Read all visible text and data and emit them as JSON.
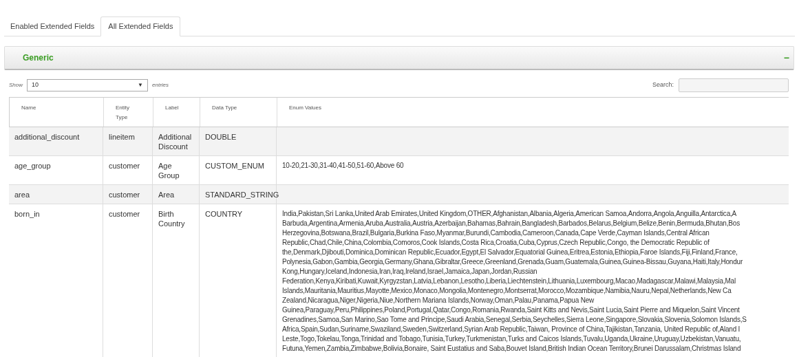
{
  "tabs": [
    {
      "label": "Enabled Extended Fields",
      "selected": false
    },
    {
      "label": "All Extended Fields",
      "selected": true
    }
  ],
  "panel": {
    "title": "Generic",
    "expanded": true,
    "toggle": "−"
  },
  "length_menu": {
    "before": "Show",
    "value": "10",
    "caret": "▼",
    "after": "entries"
  },
  "search": {
    "label": "Search:"
  },
  "table": {
    "columns": [
      [
        "Name"
      ],
      [
        "Entity",
        "Type"
      ],
      [
        "Label"
      ],
      [
        "Data Type"
      ],
      [
        "Enum Values"
      ]
    ],
    "rows": [
      {
        "name": "additional_discount",
        "entity_type": "lineitem",
        "label": [
          "Additional",
          "Discount"
        ],
        "data_type": "DOUBLE",
        "enum_values": []
      },
      {
        "name": "age_group",
        "entity_type": "customer",
        "label": [
          "Age",
          "Group"
        ],
        "data_type": "CUSTOM_ENUM",
        "enum_values": [
          "10-20,21-30,31-40,41-50,51-60,Above 60"
        ]
      },
      {
        "name": "area",
        "entity_type": "customer",
        "label": [
          "Area"
        ],
        "data_type": "STANDARD_STRING",
        "enum_values": []
      },
      {
        "name": "born_in",
        "entity_type": "customer",
        "label": [
          "Birth",
          "Country"
        ],
        "data_type": "COUNTRY",
        "enum_values": [
          "India,Pakistan,Sri Lanka,United Arab Emirates,United Kingdom,OTHER,Afghanistan,Albania,Algeria,American Samoa,Andorra,Angola,Anguilla,Antarctica,A",
          "Barbuda,Argentina,Armenia,Aruba,Australia,Austria,Azerbaijan,Bahamas,Bahrain,Bangladesh,Barbados,Belarus,Belgium,Belize,Benin,Bermuda,Bhutan,Bos",
          "Herzegovina,Botswana,Brazil,Bulgaria,Burkina Faso,Myanmar,Burundi,Cambodia,Cameroon,Canada,Cape Verde,Cayman Islands,Central African",
          "Republic,Chad,Chile,China,Colombia,Comoros,Cook Islands,Costa Rica,Croatia,Cuba,Cyprus,Czech Republic,Congo, the Democratic Republic of",
          "the,Denmark,Djibouti,Dominica,Dominican Republic,Ecuador,Egypt,El Salvador,Equatorial Guinea,Eritrea,Estonia,Ethiopia,Faroe Islands,Fiji,Finland,France,",
          "Polynesia,Gabon,Gambia,Georgia,Germany,Ghana,Gibraltar,Greece,Greenland,Grenada,Guam,Guatemala,Guinea,Guinea-Bissau,Guyana,Haiti,Italy,Hondur",
          "Kong,Hungary,Iceland,Indonesia,Iran,Iraq,Ireland,Israel,Jamaica,Japan,Jordan,Russian",
          "Federation,Kenya,Kiribati,Kuwait,Kyrgyzstan,Latvia,Lebanon,Lesotho,Liberia,Liechtenstein,Lithuania,Luxembourg,Macao,Madagascar,Malawi,Malaysia,Mal",
          "Islands,Mauritania,Mauritius,Mayotte,Mexico,Monaco,Mongolia,Montenegro,Montserrat,Morocco,Mozambique,Namibia,Nauru,Nepal,Netherlands,New Ca",
          "Zealand,Nicaragua,Niger,Nigeria,Niue,Northern Mariana Islands,Norway,Oman,Palau,Panama,Papua New",
          "Guinea,Paraguay,Peru,Philippines,Poland,Portugal,Qatar,Congo,Romania,Rwanda,Saint Kitts and Nevis,Saint Lucia,Saint Pierre and Miquelon,Saint Vincent",
          "Grenadines,Samoa,San Marino,Sao Tome and Principe,Saudi Arabia,Senegal,Serbia,Seychelles,Sierra Leone,Singapore,Slovakia,Slovenia,Solomon Islands,S",
          "Africa,Spain,Sudan,Suriname,Swaziland,Sweden,Switzerland,Syrian Arab Republic,Taiwan, Province of China,Tajikistan,Tanzania, United Republic of,Aland I",
          "Leste,Togo,Tokelau,Tonga,Trinidad and Tobago,Tunisia,Turkey,Turkmenistan,Turks and Caicos Islands,Tuvalu,Uganda,Ukraine,Uruguay,Uzbekistan,Vanuatu,",
          "Futuna,Yemen,Zambia,Zimbabwe,Bolivia,Bonaire, Saint Eustatius and Saba,Bouvet Island,British Indian Ocean Territory,Brunei Darussalam,Christmas Island"
        ]
      }
    ]
  }
}
